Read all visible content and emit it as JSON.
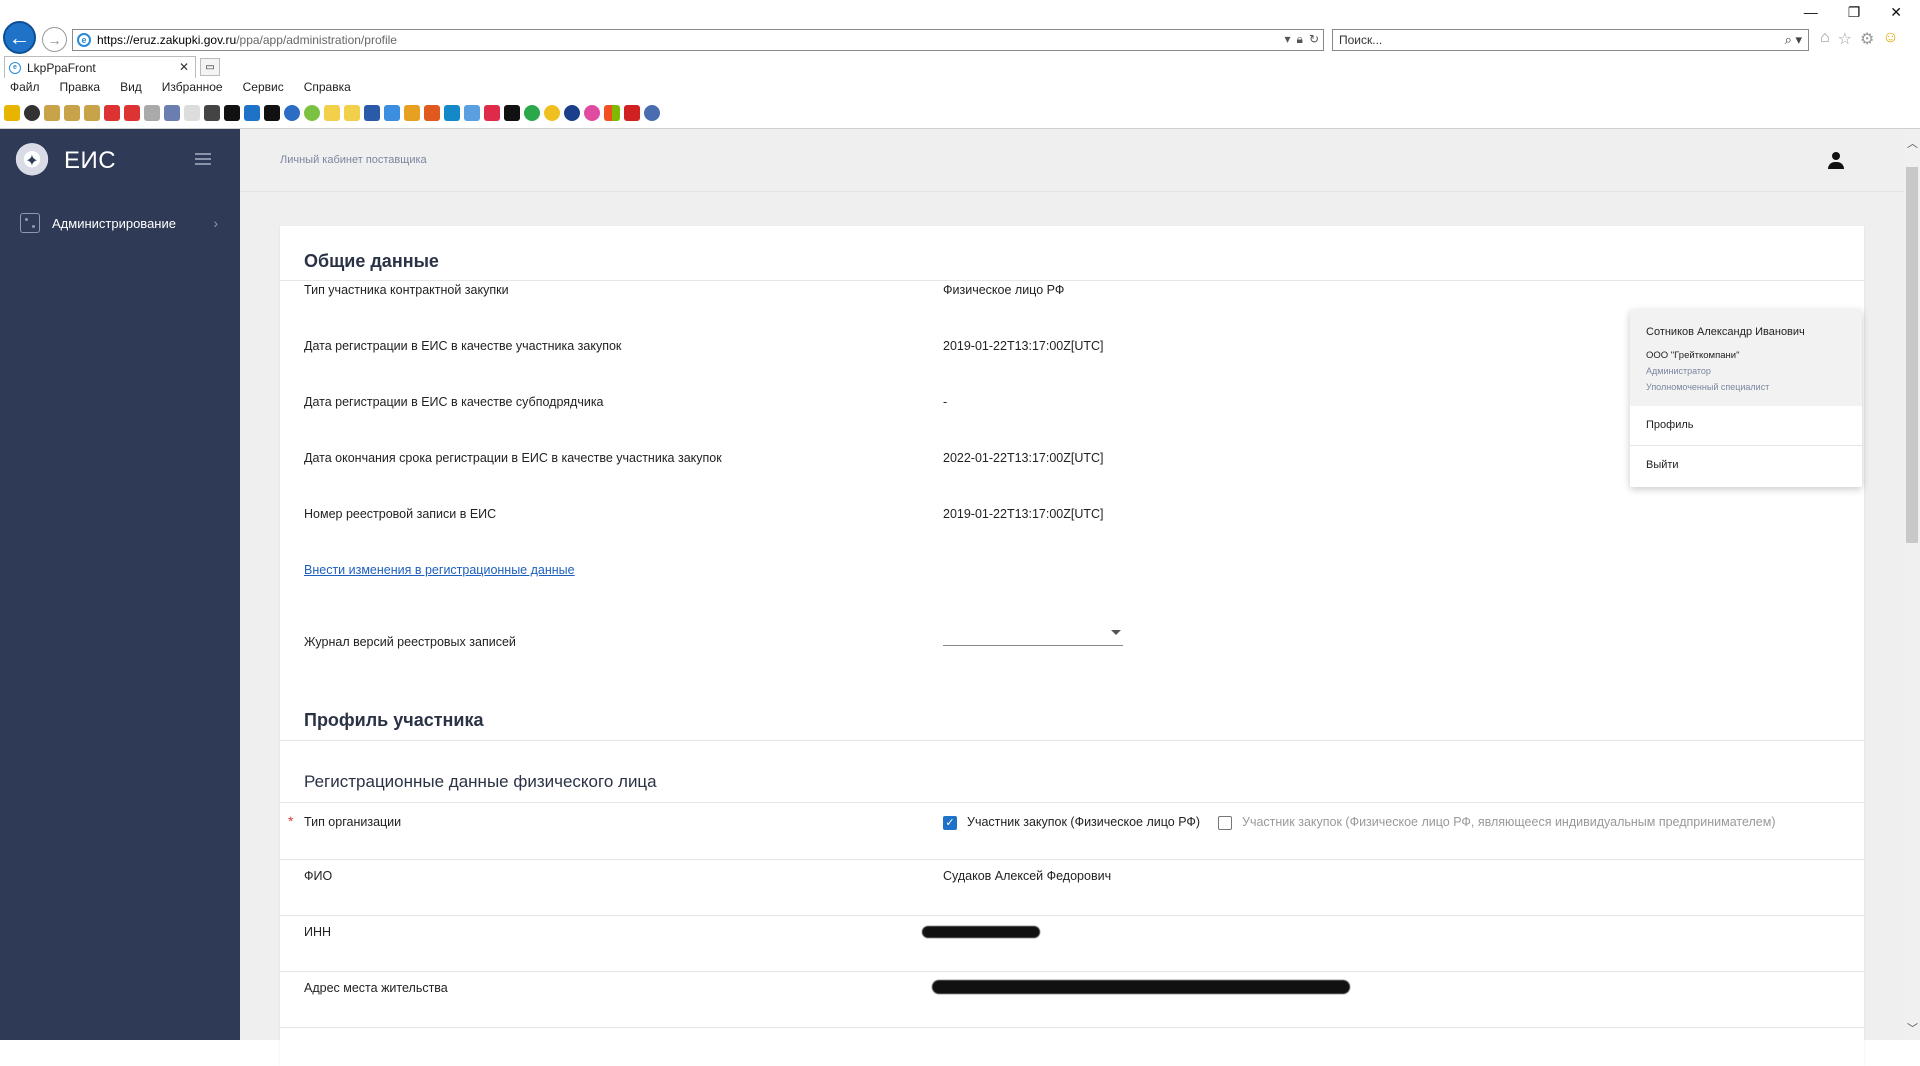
{
  "browser": {
    "url_host": "https://eruz.zakupki.gov.ru",
    "url_path": "/ppa/app/administration/profile",
    "search_placeholder": "Поиск...",
    "tab_title": "LkpPpaFront",
    "menu": [
      "Файл",
      "Правка",
      "Вид",
      "Избранное",
      "Сервис",
      "Справка"
    ],
    "window_controls": [
      "—",
      "❐",
      "✕"
    ],
    "icons": [
      "home-icon",
      "star-icon",
      "gear-icon",
      "smile-icon"
    ]
  },
  "sidebar": {
    "brand": "ЕИС",
    "items": [
      {
        "label": "Администрирование"
      }
    ]
  },
  "topbar": {
    "breadcrumb": "Личный кабинет поставщика"
  },
  "user_menu": {
    "name": "Сотников Александр Иванович",
    "org": "ООО \"Грейткомпани\"",
    "role1": "Администратор",
    "role2": "Уполномоченный специалист",
    "items": [
      "Профиль",
      "Выйти"
    ]
  },
  "general": {
    "title": "Общие данные",
    "rows": [
      {
        "label": "Тип участника контрактной закупки",
        "value": "Физическое лицо РФ"
      },
      {
        "label": "Дата регистрации в ЕИС в качестве участника закупок",
        "value": "2019-01-22T13:17:00Z[UTC]"
      },
      {
        "label": "Дата регистрации в ЕИС в качестве субподрядчика",
        "value": "-"
      },
      {
        "label": "Дата окончания срока регистрации в ЕИС в качестве участника закупок",
        "value": "2022-01-22T13:17:00Z[UTC]"
      },
      {
        "label": "Номер реестровой записи в ЕИС",
        "value": "2019-01-22T13:17:00Z[UTC]"
      }
    ],
    "edit_link": "Внести изменения в регистрационные данные",
    "journal_label": "Журнал версий реестровых записей",
    "journal_value": ""
  },
  "profile": {
    "title": "Профиль участника",
    "subtitle": "Регистрационные данные физического лица",
    "org_type_label": "Тип организации",
    "required_mark": "*",
    "org_type_options": [
      {
        "label": "Участник закупок (Физическое лицо РФ)",
        "checked": true
      },
      {
        "label": "Участник закупок (Физическое лицо РФ, являющееся индивидуальным предпринимателем)",
        "checked": false
      }
    ],
    "fio_label": "ФИО",
    "fio_value": "Судаков Алексей Федорович",
    "inn_label": "ИНН",
    "address_label": "Адрес места жительства"
  }
}
